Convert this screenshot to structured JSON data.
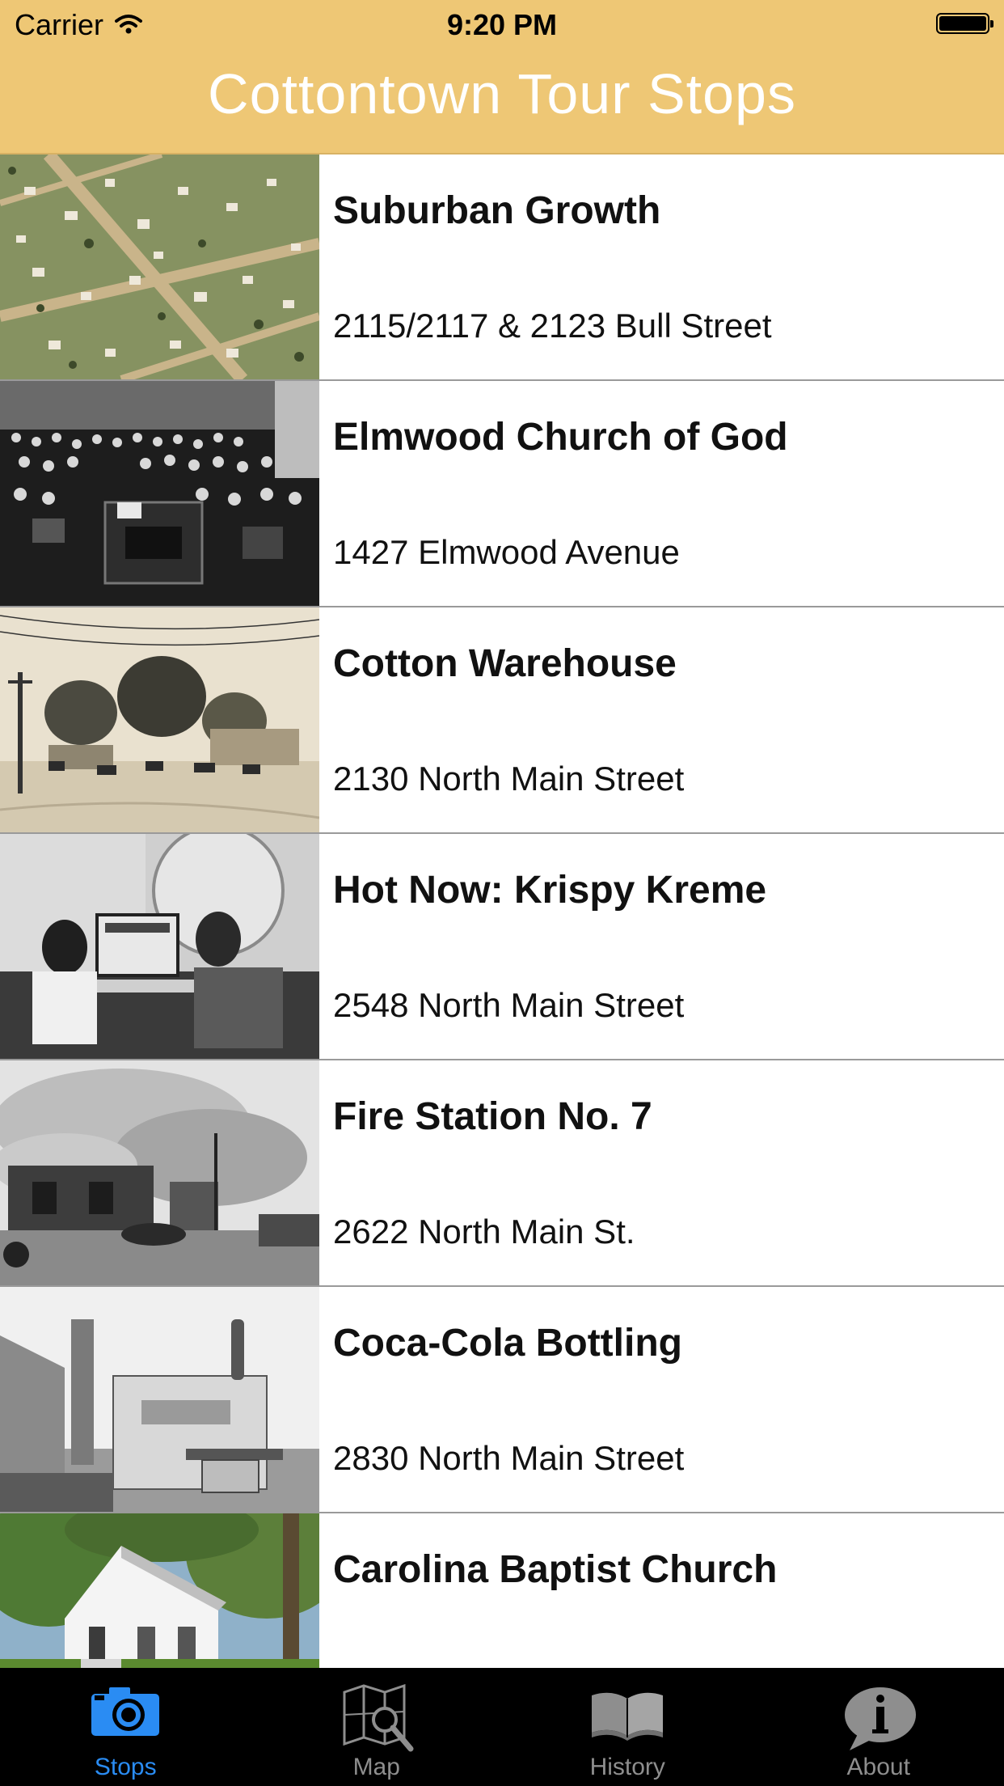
{
  "status_bar": {
    "carrier": "Carrier",
    "time": "9:20 PM"
  },
  "nav": {
    "title": "Cottontown Tour Stops",
    "color": "#eec775"
  },
  "stops": [
    {
      "title": "Suburban Growth",
      "address": "2115/2117 & 2123 Bull Street"
    },
    {
      "title": "Elmwood Church of God",
      "address": "1427 Elmwood Avenue"
    },
    {
      "title": "Cotton Warehouse",
      "address": "2130 North Main Street"
    },
    {
      "title": "Hot Now: Krispy Kreme",
      "address": "2548 North Main Street"
    },
    {
      "title": "Fire Station No. 7",
      "address": "2622 North Main St."
    },
    {
      "title": "Coca-Cola Bottling",
      "address": "2830 North Main Street"
    },
    {
      "title": "Carolina Baptist Church",
      "address": ""
    }
  ],
  "tabs": [
    {
      "label": "Stops",
      "icon": "camera-icon",
      "active": true
    },
    {
      "label": "Map",
      "icon": "map-search-icon",
      "active": false
    },
    {
      "label": "History",
      "icon": "book-icon",
      "active": false
    },
    {
      "label": "About",
      "icon": "info-bubble-icon",
      "active": false
    }
  ],
  "colors": {
    "accent": "#2a8cf3",
    "tab_inactive": "#8e8e8e",
    "tab_bar": "#000000"
  }
}
